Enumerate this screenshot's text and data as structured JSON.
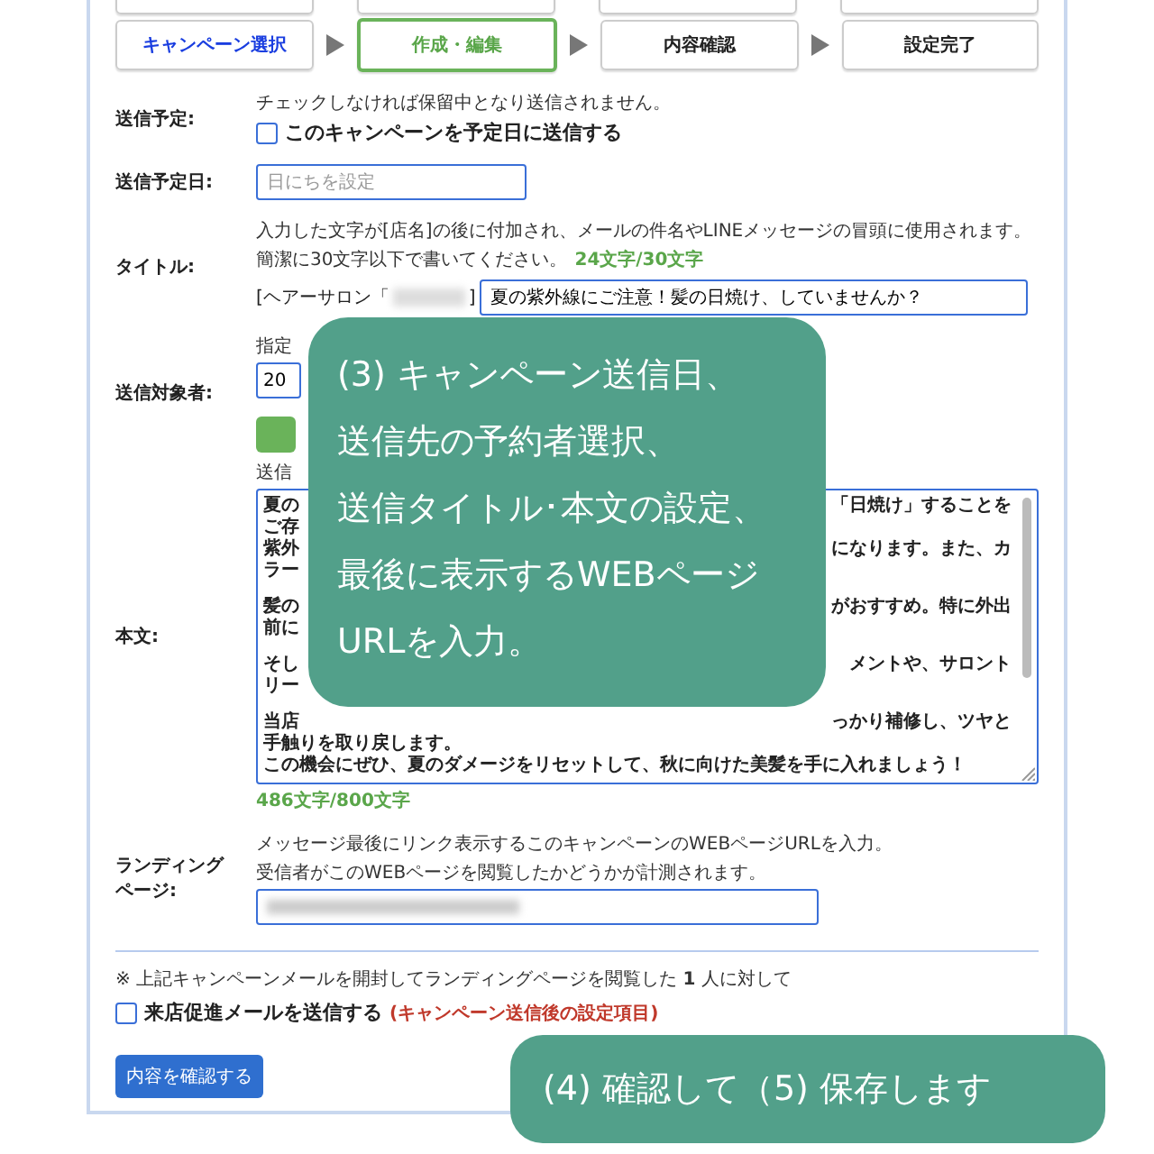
{
  "steps": [
    {
      "label": "キャンペーン選択",
      "completed": true,
      "selected": false
    },
    {
      "label": "作成・編集",
      "completed": false,
      "selected": true
    },
    {
      "label": "内容確認",
      "completed": false,
      "selected": false
    },
    {
      "label": "設定完了",
      "completed": false,
      "selected": false
    }
  ],
  "schedule": {
    "label": "送信予定:",
    "hint": "チェックしなければ保留中となり送信されません。",
    "checkbox": {
      "label": "このキャンペーンを予定日に送信する",
      "checked": false
    }
  },
  "send_date": {
    "label": "送信予定日:",
    "placeholder": "日にちを設定"
  },
  "title": {
    "label": "タイトル:",
    "hint": "入力した文字が[店名]の後に付加され、メールの件名やLINEメッセージの冒頭に使用されます。",
    "hint_2": "簡潔に30文字以下で書いてください。",
    "count": "24文字/30文字",
    "prefix": "[ヘアーサロン「",
    "suffix": "]",
    "value": "夏の紫外線にご注意！髪の日焼け、していませんか？"
  },
  "recipients": {
    "label": "送信対象者:",
    "hint": "指定",
    "value": "20"
  },
  "body": {
    "label": "本文:",
    "hint": "送信",
    "count": "486文字/800文字",
    "paragraphs": [
      {
        "lines": [
          {
            "left": "夏の",
            "right": "「日焼け」することを"
          },
          {
            "left": "ご存"
          },
          {
            "left": "紫外",
            "right": "になります。また、カ"
          },
          {
            "left": "ラー"
          }
        ]
      },
      {
        "lines": [
          {
            "left": "髪の",
            "right": "がおすすめ。特に外出"
          },
          {
            "left": "前に"
          }
        ]
      },
      {
        "lines": [
          {
            "left": "そし",
            "right": "メントや、サロント"
          },
          {
            "left": "リー"
          }
        ]
      },
      {
        "lines": [
          {
            "left": "当店",
            "right": "っかり補修し、ツヤと"
          },
          {
            "left": "手触りを取り戻します。"
          },
          {
            "left": "この機会にぜひ、夏のダメージをリセットして、秋に向けた美髪を手に入れましょう！"
          }
        ]
      }
    ]
  },
  "landing": {
    "label_lines": [
      "ランディング",
      "ページ:"
    ],
    "hint": "メッセージ最後にリンク表示するこのキャンペーンのWEBページURLを入力。",
    "hint_2": "受信者がこのWEBページを閲覧したかどうかが計測されます。"
  },
  "followup": {
    "note_before": "※ 上記キャンペーンメールを開封してランディングページを閲覧した",
    "count": "1",
    "note_after": "人に対して",
    "checkbox": {
      "label": "来店促進メールを送信する",
      "checked": false
    },
    "tag": "(キャンペーン送信後の設定項目)"
  },
  "confirm_button": "内容を確認する",
  "callouts": [
    {
      "lines": [
        "(3) キャンペーン送信日、",
        "送信先の予約者選択、",
        "送信タイトル･本文の設定、",
        "最後に表示するWEBページ",
        "URLを入力。"
      ]
    },
    {
      "lines": [
        "(4) 確認して（5) 保存します"
      ]
    }
  ]
}
